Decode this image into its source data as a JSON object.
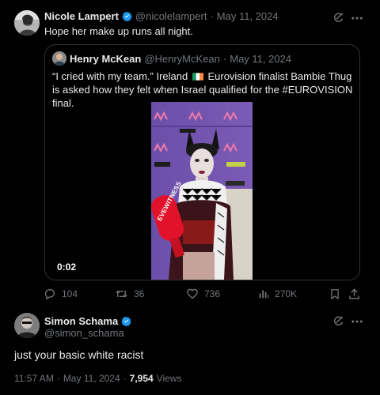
{
  "main_tweet": {
    "author_name": "Nicole Lampert",
    "handle": "@nicolelampert",
    "separator": "·",
    "date": "May 11, 2024",
    "text": "Hope her make up runs all night."
  },
  "quoted_tweet": {
    "author_name": "Henry McKean",
    "handle": "@HenryMcKean",
    "separator": "·",
    "date": "May 11, 2024",
    "text_before_flag": "“I cried with my team.” Ireland",
    "text_after_flag": "Eurovision finalist Bambie Thug is asked how they felt when Israel qualified for the #EUROVISION final.",
    "video_duration": "0:02",
    "mic_text": "EVEWITNESS"
  },
  "actions": {
    "replies": "104",
    "retweets": "36",
    "likes": "736",
    "views": "270K"
  },
  "reply": {
    "author_name": "Simon Schama",
    "handle": "@simon_schama",
    "text": "just your basic white racist",
    "time": "11:57 AM",
    "separator": "·",
    "date": "May 11, 2024",
    "separator2": "·",
    "views_count": "7,954",
    "views_label": "Views"
  },
  "colors": {
    "background": "#000000",
    "text": "#e7e9ea",
    "muted": "#71767b",
    "verified": "#1d9bf0",
    "border": "#2f3336"
  }
}
